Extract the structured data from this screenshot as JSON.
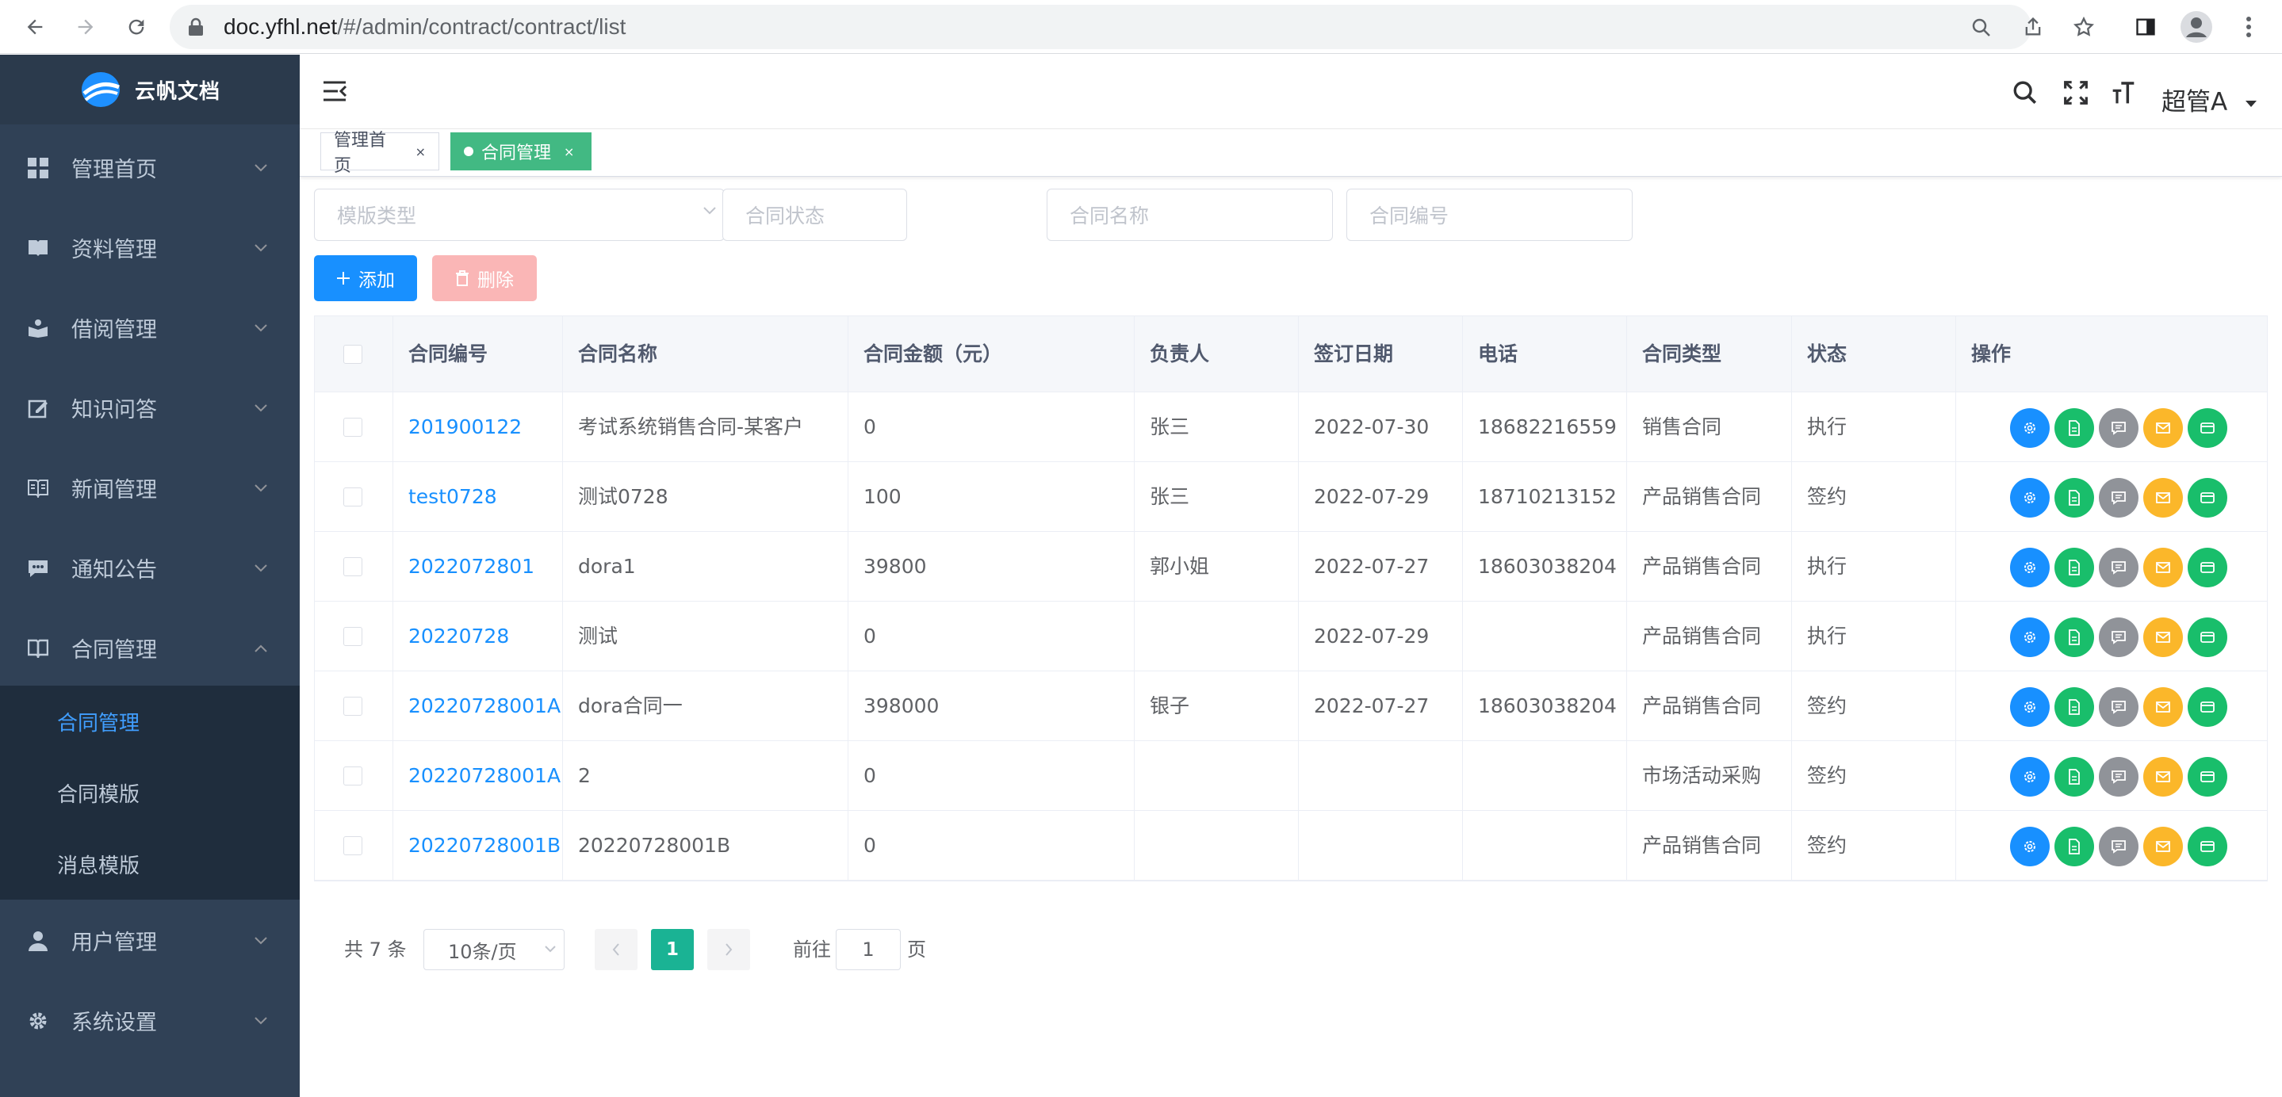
{
  "browser": {
    "url_host": "doc.yfhl.net",
    "url_path": "/#/admin/contract/contract/list"
  },
  "app": {
    "logo_text": "云帆文档"
  },
  "sidebar": {
    "items": [
      {
        "label": "管理首页",
        "icon": "dashboard-icon"
      },
      {
        "label": "资料管理",
        "icon": "book-icon"
      },
      {
        "label": "借阅管理",
        "icon": "reading-icon"
      },
      {
        "label": "知识问答",
        "icon": "edit-icon"
      },
      {
        "label": "新闻管理",
        "icon": "news-icon"
      },
      {
        "label": "通知公告",
        "icon": "message-icon"
      },
      {
        "label": "合同管理",
        "icon": "contract-icon"
      },
      {
        "label": "用户管理",
        "icon": "user-icon"
      },
      {
        "label": "系统设置",
        "icon": "gear-icon"
      }
    ],
    "submenu": [
      "合同管理",
      "合同模版",
      "消息模版"
    ]
  },
  "header": {
    "user_name": "超管A"
  },
  "tags": [
    {
      "label": "管理首页",
      "close": "×"
    },
    {
      "label": "合同管理",
      "close": "×"
    }
  ],
  "filters": {
    "template_type": "模版类型",
    "contract_status": "合同状态",
    "contract_name": "合同名称",
    "contract_no": "合同编号"
  },
  "toolbar": {
    "add_label": "添加",
    "delete_label": "删除"
  },
  "table": {
    "columns": [
      "合同编号",
      "合同名称",
      "合同金额（元）",
      "负责人",
      "签订日期",
      "电话",
      "合同类型",
      "状态",
      "操作"
    ],
    "rows": [
      [
        "201900122",
        "考试系统销售合同-某客户",
        "0",
        "张三",
        "2022-07-30",
        "18682216559",
        "销售合同",
        "执行"
      ],
      [
        "test0728",
        "测试0728",
        "100",
        "张三",
        "2022-07-29",
        "18710213152",
        "产品销售合同",
        "签约"
      ],
      [
        "2022072801",
        "dora1",
        "39800",
        "郭小姐",
        "2022-07-27",
        "18603038204",
        "产品销售合同",
        "执行"
      ],
      [
        "20220728",
        "测试",
        "0",
        "",
        "2022-07-29",
        "",
        "产品销售合同",
        "执行"
      ],
      [
        "20220728001A",
        "dora合同一",
        "398000",
        "银子",
        "2022-07-27",
        "18603038204",
        "产品销售合同",
        "签约"
      ],
      [
        "20220728001A",
        "2",
        "0",
        "",
        "",
        "",
        "市场活动采购",
        "签约"
      ],
      [
        "20220728001B",
        "20220728001B",
        "0",
        "",
        "",
        "",
        "产品销售合同",
        "签约"
      ]
    ],
    "actions": [
      {
        "name": "settings-action-icon",
        "color": "#1890ff"
      },
      {
        "name": "document-action-icon",
        "color": "#19be6b"
      },
      {
        "name": "comment-action-icon",
        "color": "#909399"
      },
      {
        "name": "mail-action-icon",
        "color": "#fbb72a"
      },
      {
        "name": "card-action-icon",
        "color": "#19be6b"
      }
    ]
  },
  "pagination": {
    "total_text": "共 7 条",
    "page_size": "10条/页",
    "current_page": "1",
    "goto_prefix": "前往",
    "goto_value": "1",
    "goto_suffix": "页"
  },
  "colors": {
    "sidebar_bg": "#304156",
    "active_tag": "#42b983",
    "primary": "#1890ff",
    "pagination_active": "#1ab394"
  }
}
